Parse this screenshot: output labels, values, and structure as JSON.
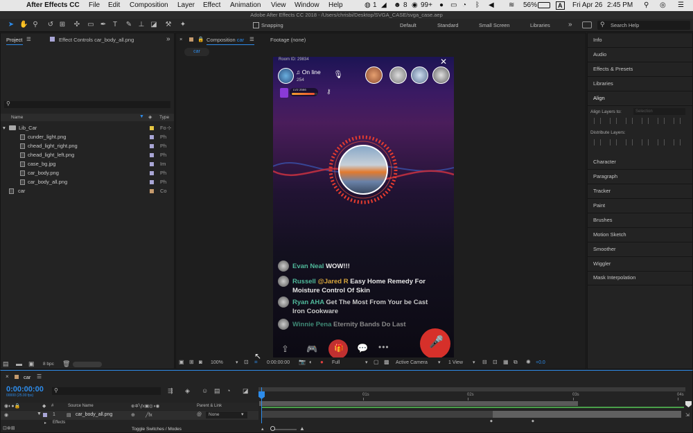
{
  "menubar": {
    "app": "After Effects CC",
    "items": [
      "File",
      "Edit",
      "Composition",
      "Layer",
      "Effect",
      "Animation",
      "View",
      "Window",
      "Help"
    ],
    "status": {
      "messages": "1",
      "wechat": "8",
      "mail": "99+",
      "battery": "56%",
      "date": "Fri Apr 26",
      "time": "2:45 PM"
    }
  },
  "titlebar": {
    "title": "Adobe After Effects CC 2018 - /Users/chrisbi/Desktop/SVGA_CASE/svga_case.aep"
  },
  "toolbar": {
    "snapping": "Snapping",
    "workspaces": [
      "Default",
      "Standard",
      "Small Screen",
      "Libraries"
    ],
    "search_placeholder": "Search Help"
  },
  "project": {
    "tab": "Project",
    "effect_tab": "Effect Controls car_body_all.png",
    "search_placeholder": "",
    "col_name": "Name",
    "col_type": "Type",
    "rows": [
      {
        "name": "Lib_Car",
        "type": "Fo",
        "color": "#e6c642"
      },
      {
        "name": "cunder_light.png",
        "type": "Ph",
        "color": "#a9a6d6"
      },
      {
        "name": "chead_light_right.png",
        "type": "Ph",
        "color": "#a9a6d6"
      },
      {
        "name": "chead_light_left.png",
        "type": "Ph",
        "color": "#a9a6d6"
      },
      {
        "name": "case_bg.jpg",
        "type": "Im",
        "color": "#a9a6d6"
      },
      {
        "name": "car_body.png",
        "type": "Ph",
        "color": "#a9a6d6"
      },
      {
        "name": "car_body_all.png",
        "type": "Ph",
        "color": "#a9a6d6"
      },
      {
        "name": "car",
        "type": "Co",
        "color": "#c59a6d"
      }
    ],
    "bpc": "8 bpc"
  },
  "viewer": {
    "tab": "Composition",
    "tab_name": "car",
    "footage_tab": "Footage (none)",
    "sub_tab": "car",
    "zoom": "100%",
    "timecode": "0:00:00:00",
    "resolution": "Full",
    "camera": "Active Camera",
    "views": "1 View",
    "exposure": "+0.0"
  },
  "phone": {
    "room_id": "Room ID: 29834",
    "status": "On line",
    "count": "254",
    "level": "LV2 2566",
    "chats": [
      {
        "user": "Evan Neal",
        "msg": "WOW!!!",
        "user_color": "#4fb89a",
        "msg_color": "#eeeeee"
      },
      {
        "user": "Russell",
        "mention": "@Jared R",
        "msg": "Easy Home Remedy For Moisture Control Of Skin",
        "user_color": "#4fb89a",
        "mention_color": "#d8a63c",
        "msg_color": "#e6e6e6"
      },
      {
        "user": "Ryan AHA",
        "msg": "Get The Most From Your be Cast Iron Cookware",
        "user_color": "#4fb89a",
        "msg_color": "#c8c8c8"
      },
      {
        "user": "Winnie Pena",
        "msg": "Eternity Bands Do Last",
        "user_color": "#3f8a76",
        "msg_color": "#888888"
      }
    ]
  },
  "right_panels": [
    "Info",
    "Audio",
    "Effects & Presets",
    "Libraries",
    "Align",
    "Character",
    "Paragraph",
    "Tracker",
    "Paint",
    "Brushes",
    "Motion Sketch",
    "Smoother",
    "Wiggler",
    "Mask Interpolation"
  ],
  "align": {
    "align_layers_to": "Align Layers to:",
    "selection": "Selection",
    "distribute": "Distribute Layers:"
  },
  "timeline": {
    "comp": "car",
    "timecode": "0:00:00:00",
    "fps": "00000 (25.00 fps)",
    "col_source": "Source Name",
    "col_parent": "Parent & Link",
    "layer_num": "1",
    "layer_name": "car_body_all.png",
    "parent": "None",
    "effects": "Effects",
    "toggle": "Toggle Switches / Modes",
    "ruler": [
      "0s",
      "01s",
      "02s",
      "03s",
      "04s"
    ]
  },
  "colors": {
    "accent": "#2d8ceb",
    "bar_green": "#6ab04c",
    "phone_bg_top": "#2a1560",
    "phone_bg_bottom": "#0a0714"
  }
}
